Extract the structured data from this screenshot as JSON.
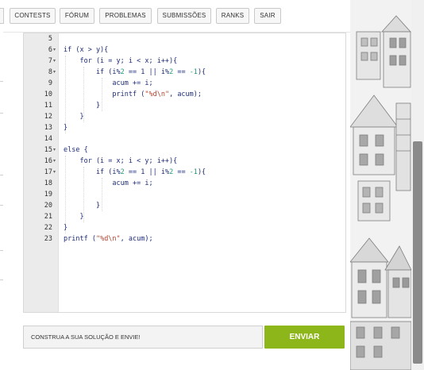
{
  "nav": {
    "items": [
      "CONTESTS",
      "FÓRUM",
      "PROBLEMAS",
      "SUBMISSÕES",
      "RANKS",
      "SAIR"
    ]
  },
  "editor": {
    "lines": [
      {
        "n": "5",
        "fold": false,
        "text": ""
      },
      {
        "n": "6",
        "fold": true,
        "text": "if (x > y){"
      },
      {
        "n": "7",
        "fold": true,
        "text": "    for (i = y; i < x; i++){"
      },
      {
        "n": "8",
        "fold": true,
        "text": "        if (i%2 == 1 || i%2 == -1){"
      },
      {
        "n": "9",
        "fold": false,
        "text": "            acum += i;"
      },
      {
        "n": "10",
        "fold": false,
        "text": "            printf (\"%d\\n\", acum);"
      },
      {
        "n": "11",
        "fold": false,
        "text": "        }"
      },
      {
        "n": "12",
        "fold": false,
        "text": "    }"
      },
      {
        "n": "13",
        "fold": false,
        "text": "}"
      },
      {
        "n": "14",
        "fold": false,
        "text": ""
      },
      {
        "n": "15",
        "fold": true,
        "text": "else {"
      },
      {
        "n": "16",
        "fold": true,
        "text": "    for (i = x; i < y; i++){"
      },
      {
        "n": "17",
        "fold": true,
        "text": "        if (i%2 == 1 || i%2 == -1){"
      },
      {
        "n": "18",
        "fold": false,
        "text": "            acum += i;"
      },
      {
        "n": "19",
        "fold": false,
        "text": ""
      },
      {
        "n": "20",
        "fold": false,
        "text": "        }"
      },
      {
        "n": "21",
        "fold": false,
        "text": "    }"
      },
      {
        "n": "22",
        "fold": false,
        "text": "}"
      },
      {
        "n": "23",
        "fold": false,
        "text": "printf (\"%d\\n\", acum);"
      }
    ]
  },
  "submit": {
    "placeholder": "CONSTRUA A SUA SOLUÇÃO E ENVIE!",
    "button": "ENVIAR"
  },
  "colors": {
    "accent": "#8db61a",
    "keyword": "#1f2d7a",
    "number": "#2a9a7a",
    "string": "#b0442f"
  }
}
